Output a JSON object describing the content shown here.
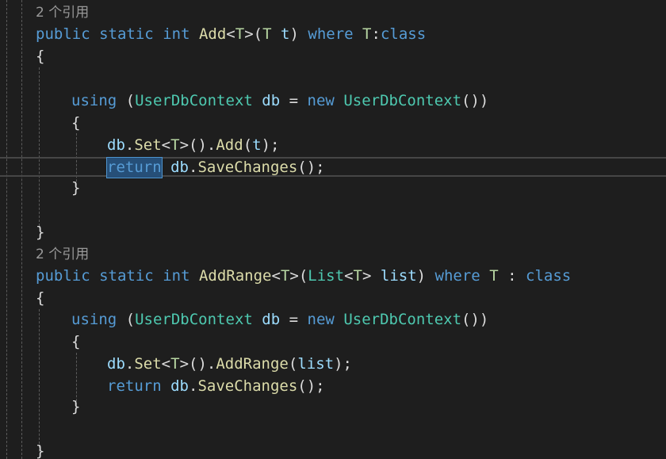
{
  "editor": {
    "colors": {
      "background": "#1e1e1e",
      "keyword": "#569cd6",
      "type": "#4ec9b0",
      "type_parameter": "#b8d7a3",
      "method": "#dcdcaa",
      "identifier": "#9cdcfe",
      "plain": "#dcdcdc",
      "codelens": "#999999",
      "word_highlight": "#264f78"
    },
    "methods": [
      {
        "reference_count": "2 个引用",
        "signature": {
          "mod1": "public",
          "mod2": "static",
          "ret": "int",
          "name": "Add",
          "lt": "<",
          "tparam": "T",
          "gt": ">",
          "open": "(",
          "ptype": "T",
          "pname": "t",
          "close": ")",
          "where": "where",
          "constraint_target": "T",
          "colon": ":",
          "constraint": "class"
        },
        "open_brace": "{",
        "using_line": {
          "kw_using": "using",
          "paren_open": "(",
          "ctx_type": "UserDbContext",
          "var": "db",
          "eq": "=",
          "kw_new": "new",
          "ctx_type2": "UserDbContext",
          "paren_close": "())"
        },
        "inner_open": "{",
        "stmt1": {
          "obj": "db",
          "dot": ".",
          "method": "Set",
          "lt": "<",
          "tparam": "T",
          "gt": ">",
          "call": "().",
          "method2": "Add",
          "args_open": "(",
          "arg": "t",
          "args_close": ");"
        },
        "stmt2": {
          "kw_return": "return",
          "obj": "db",
          "dot": ".",
          "method": "SaveChanges",
          "tail": "();"
        },
        "inner_close": "}",
        "close_brace": "}"
      },
      {
        "reference_count": "2 个引用",
        "signature": {
          "mod1": "public",
          "mod2": "static",
          "ret": "int",
          "name": "AddRange",
          "lt": "<",
          "tparam": "T",
          "gt": ">",
          "open": "(",
          "ptype": "List",
          "plt": "<",
          "ptparam": "T",
          "pgt": ">",
          "pname": "list",
          "close": ")",
          "where": "where",
          "constraint_target": "T",
          "colon": ":",
          "constraint": "class"
        },
        "open_brace": "{",
        "using_line": {
          "kw_using": "using",
          "paren_open": "(",
          "ctx_type": "UserDbContext",
          "var": "db",
          "eq": "=",
          "kw_new": "new",
          "ctx_type2": "UserDbContext",
          "paren_close": "())"
        },
        "inner_open": "{",
        "stmt1": {
          "obj": "db",
          "dot": ".",
          "method": "Set",
          "lt": "<",
          "tparam": "T",
          "gt": ">",
          "call": "().",
          "method2": "AddRange",
          "args_open": "(",
          "arg": "list",
          "args_close": ");"
        },
        "stmt2": {
          "kw_return": "return",
          "obj": "db",
          "dot": ".",
          "method": "SaveChanges",
          "tail": "();"
        },
        "inner_close": "}",
        "close_brace": "}"
      }
    ]
  }
}
